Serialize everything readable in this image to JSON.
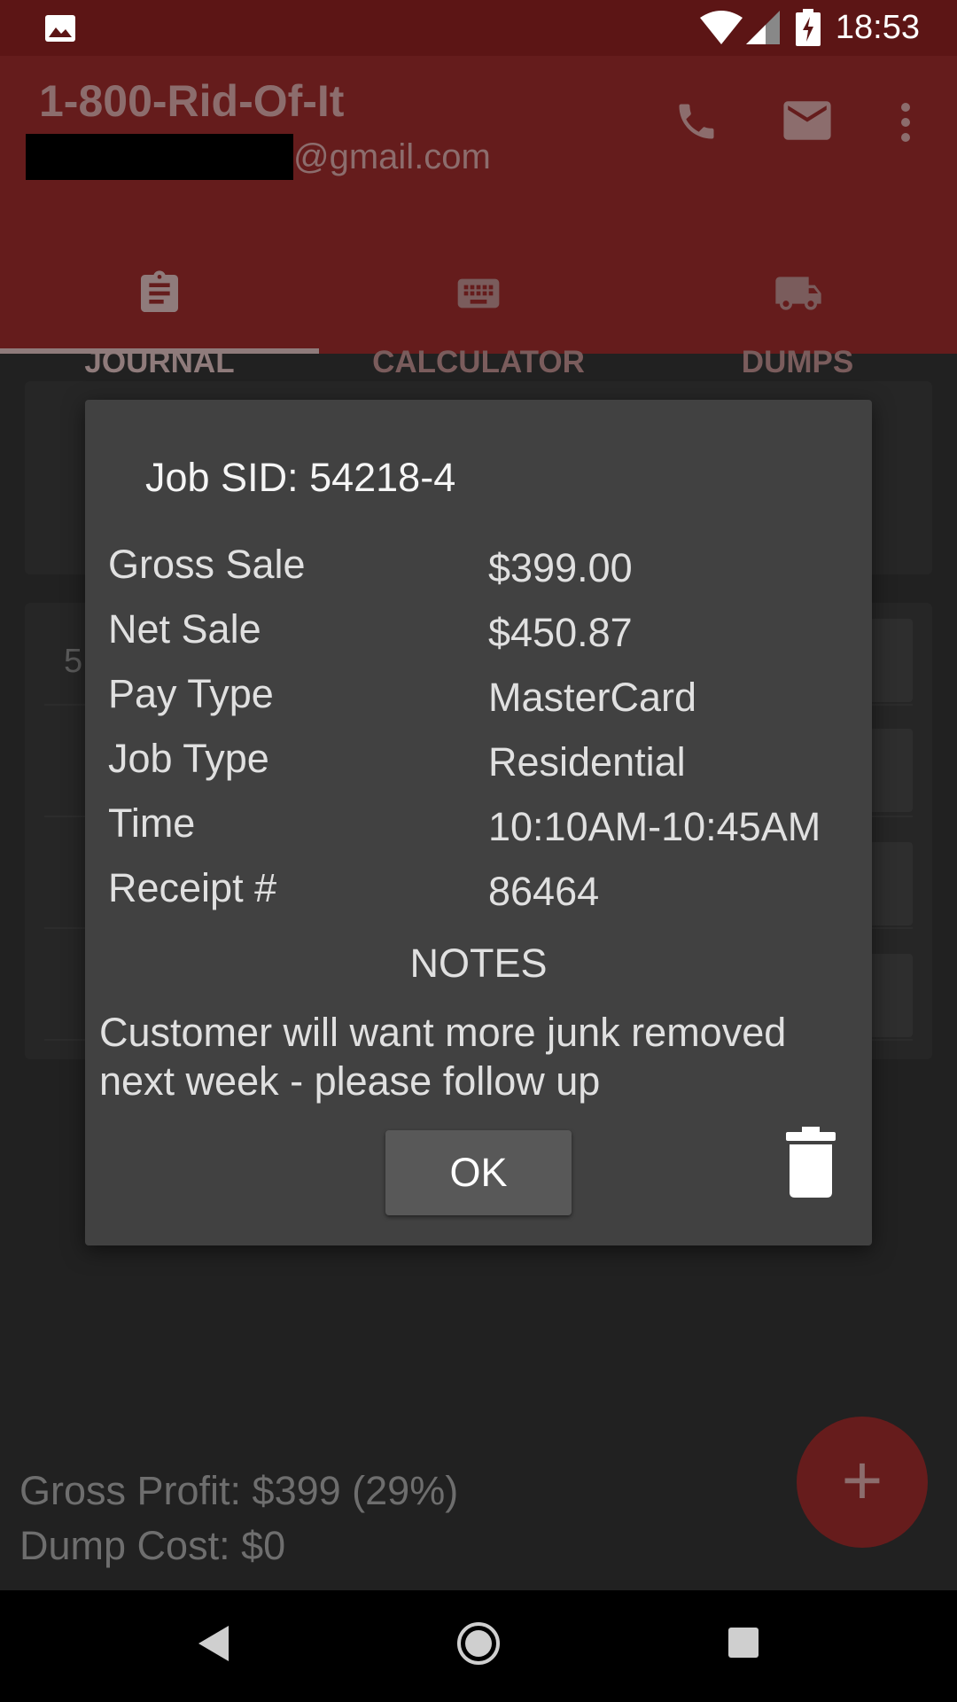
{
  "status_bar": {
    "time": "18:53"
  },
  "app_bar": {
    "title": "1-800-Rid-Of-It",
    "email_suffix": "@gmail.com",
    "tabs": [
      {
        "label": "JOURNAL",
        "icon": "clipboard-icon",
        "selected": true
      },
      {
        "label": "CALCULATOR",
        "icon": "keyboard-icon",
        "selected": false
      },
      {
        "label": "DUMPS",
        "icon": "truck-icon",
        "selected": false
      }
    ]
  },
  "background": {
    "clipped_value": "5",
    "footer": {
      "gross_profit": "Gross Profit: $399 (29%)",
      "dump_cost": "Dump Cost: $0"
    }
  },
  "dialog": {
    "title": "Job SID: 54218-4",
    "rows": [
      {
        "label": "Gross Sale",
        "value": "$399.00"
      },
      {
        "label": "Net Sale",
        "value": "$450.87"
      },
      {
        "label": "Pay Type",
        "value": "MasterCard"
      },
      {
        "label": "Job Type",
        "value": "Residential"
      },
      {
        "label": "Time",
        "value": "10:10AM-10:45AM"
      },
      {
        "label": "Receipt #",
        "value": "86464"
      }
    ],
    "notes_heading": "NOTES",
    "notes_text": "Customer will want more junk removed next week - please follow up",
    "ok_label": "OK"
  },
  "colors": {
    "app_bar": "#651c1c",
    "status_bar": "#5c1515",
    "dialog": "#414141",
    "fab": "#661c1c"
  }
}
